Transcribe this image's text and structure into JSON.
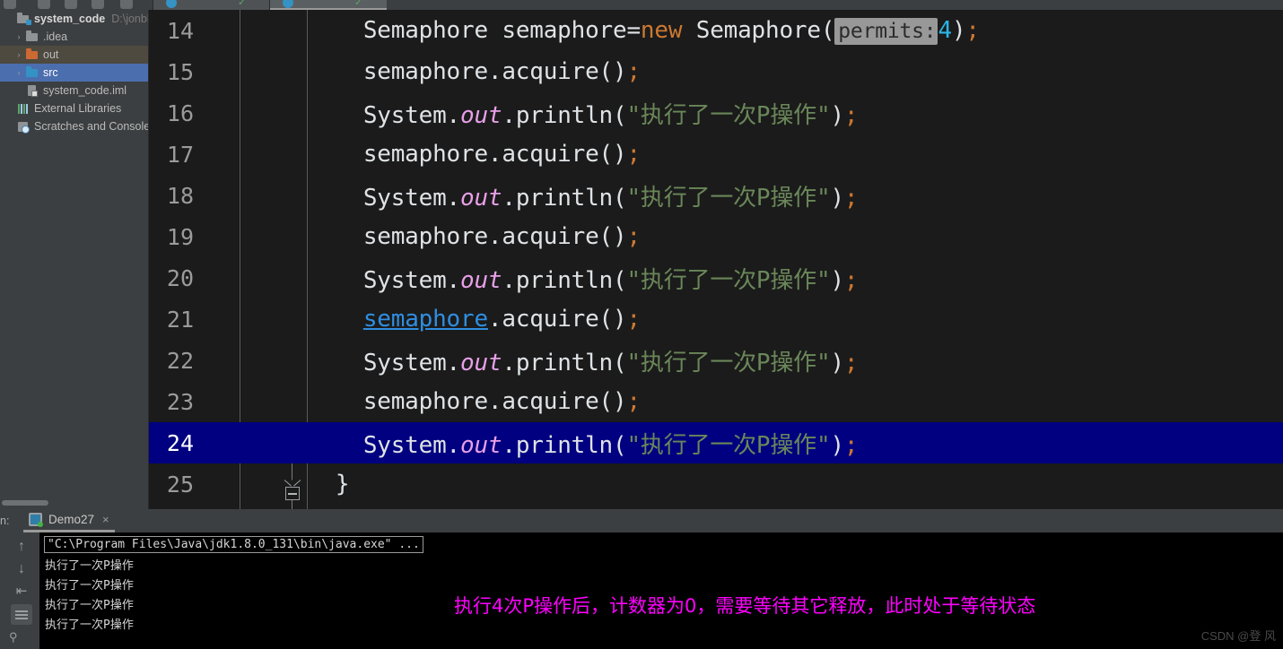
{
  "window": {
    "theme": "darcula",
    "accent_selection": "#4b6eaf",
    "caret_row_color": "#000080",
    "annotation_color": "#ff00ff"
  },
  "editor_tabs": [
    {
      "label": "",
      "active": false
    },
    {
      "label": "",
      "active": true
    }
  ],
  "project_tree": {
    "items": [
      {
        "label": "system_code",
        "path": "D:\\jonbhel",
        "icon": "module-icon",
        "arrow": "",
        "state": "normal",
        "indent": 0
      },
      {
        "label": ".idea",
        "path": "",
        "icon": "folder-icon",
        "arrow": "›",
        "state": "normal",
        "indent": 1
      },
      {
        "label": "out",
        "path": "",
        "icon": "folder-out-icon",
        "arrow": "›",
        "state": "hovered",
        "indent": 1
      },
      {
        "label": "src",
        "path": "",
        "icon": "folder-src-icon",
        "arrow": "›",
        "state": "selected",
        "indent": 1
      },
      {
        "label": "system_code.iml",
        "path": "",
        "icon": "iml-file-icon",
        "arrow": "",
        "state": "normal",
        "indent": 1
      },
      {
        "label": "External Libraries",
        "path": "",
        "icon": "libraries-icon",
        "arrow": "",
        "state": "normal",
        "indent": 0
      },
      {
        "label": "Scratches and Consoles",
        "path": "",
        "icon": "scratches-icon",
        "arrow": "",
        "state": "normal",
        "indent": 0
      }
    ]
  },
  "code": {
    "first_line_number": 14,
    "active_line_number": 24,
    "lines": [
      {
        "n": "14",
        "tokens": [
          {
            "t": "    ",
            "c": "tok-plain"
          },
          {
            "t": "Semaphore semaphore=",
            "c": "tok-plain"
          },
          {
            "t": "new",
            "c": "tok-kw"
          },
          {
            "t": " Semaphore(",
            "c": "tok-plain"
          },
          {
            "t": "permits:",
            "c": "param-hint"
          },
          {
            "t": "4",
            "c": "tok-num"
          },
          {
            "t": ")",
            "c": "tok-plain"
          },
          {
            "t": ";",
            "c": "tok-punc"
          }
        ]
      },
      {
        "n": "15",
        "tokens": [
          {
            "t": "    semaphore.acquire()",
            "c": "tok-plain"
          },
          {
            "t": ";",
            "c": "tok-punc"
          }
        ]
      },
      {
        "n": "16",
        "tokens": [
          {
            "t": "    System.",
            "c": "tok-plain"
          },
          {
            "t": "out",
            "c": "tok-static"
          },
          {
            "t": ".println(",
            "c": "tok-plain"
          },
          {
            "t": "\"执行了一次P操作\"",
            "c": "tok-str"
          },
          {
            "t": ")",
            "c": "tok-plain"
          },
          {
            "t": ";",
            "c": "tok-punc"
          }
        ]
      },
      {
        "n": "17",
        "tokens": [
          {
            "t": "    semaphore.acquire()",
            "c": "tok-plain"
          },
          {
            "t": ";",
            "c": "tok-punc"
          }
        ]
      },
      {
        "n": "18",
        "tokens": [
          {
            "t": "    System.",
            "c": "tok-plain"
          },
          {
            "t": "out",
            "c": "tok-static"
          },
          {
            "t": ".println(",
            "c": "tok-plain"
          },
          {
            "t": "\"执行了一次P操作\"",
            "c": "tok-str"
          },
          {
            "t": ")",
            "c": "tok-plain"
          },
          {
            "t": ";",
            "c": "tok-punc"
          }
        ]
      },
      {
        "n": "19",
        "tokens": [
          {
            "t": "    semaphore.acquire()",
            "c": "tok-plain"
          },
          {
            "t": ";",
            "c": "tok-punc"
          }
        ]
      },
      {
        "n": "20",
        "tokens": [
          {
            "t": "    System.",
            "c": "tok-plain"
          },
          {
            "t": "out",
            "c": "tok-static"
          },
          {
            "t": ".println(",
            "c": "tok-plain"
          },
          {
            "t": "\"执行了一次P操作\"",
            "c": "tok-str"
          },
          {
            "t": ")",
            "c": "tok-plain"
          },
          {
            "t": ";",
            "c": "tok-punc"
          }
        ]
      },
      {
        "n": "21",
        "tokens": [
          {
            "t": "    ",
            "c": "tok-plain"
          },
          {
            "t": "semaphore",
            "c": "tok-link"
          },
          {
            "t": ".acquire()",
            "c": "tok-plain"
          },
          {
            "t": ";",
            "c": "tok-punc"
          }
        ]
      },
      {
        "n": "22",
        "tokens": [
          {
            "t": "    System.",
            "c": "tok-plain"
          },
          {
            "t": "out",
            "c": "tok-static"
          },
          {
            "t": ".println(",
            "c": "tok-plain"
          },
          {
            "t": "\"执行了一次P操作\"",
            "c": "tok-str"
          },
          {
            "t": ")",
            "c": "tok-plain"
          },
          {
            "t": ";",
            "c": "tok-punc"
          }
        ]
      },
      {
        "n": "23",
        "tokens": [
          {
            "t": "    semaphore.acquire()",
            "c": "tok-plain"
          },
          {
            "t": ";",
            "c": "tok-punc"
          }
        ]
      },
      {
        "n": "24",
        "active": true,
        "tokens": [
          {
            "t": "    System.",
            "c": "tok-plain"
          },
          {
            "t": "out",
            "c": "tok-static"
          },
          {
            "t": ".println(",
            "c": "tok-plain"
          },
          {
            "t": "\"执行了一次P操作\"",
            "c": "tok-str"
          },
          {
            "t": ")",
            "c": "tok-plain"
          },
          {
            "t": ";",
            "c": "tok-punc"
          }
        ]
      },
      {
        "n": "25",
        "fold": true,
        "tokens": [
          {
            "t": "  }",
            "c": "tok-plain"
          }
        ]
      }
    ]
  },
  "run_panel": {
    "header_title": "n:",
    "tab_label": "Demo27",
    "close_label": "×",
    "toolbar": [
      {
        "name": "rerun-up-arrow-icon",
        "glyph": "↑",
        "active": false
      },
      {
        "name": "rerun-down-arrow-icon",
        "glyph": "↓",
        "active": false
      },
      {
        "name": "soft-wrap-icon",
        "glyph": "⇥",
        "active": false
      },
      {
        "name": "scroll-to-end-icon",
        "glyph": "",
        "active": true
      },
      {
        "name": "print-icon",
        "glyph": "",
        "active": false
      }
    ],
    "console_lines": [
      {
        "text": "\"C:\\Program Files\\Java\\jdk1.8.0_131\\bin\\java.exe\" ...",
        "boxed": true
      },
      {
        "text": "执行了一次P操作",
        "boxed": false
      },
      {
        "text": "执行了一次P操作",
        "boxed": false
      },
      {
        "text": "执行了一次P操作",
        "boxed": false
      },
      {
        "text": "执行了一次P操作",
        "boxed": false
      }
    ],
    "annotation": "执行4次P操作后，计数器为0，需要等待其它释放，此时处于等待状态"
  },
  "watermark": "CSDN @登 风"
}
